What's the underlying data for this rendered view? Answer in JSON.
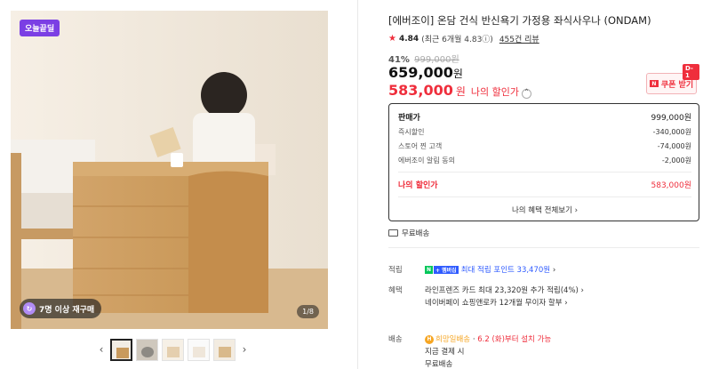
{
  "gallery": {
    "badge": "오늘끝딜",
    "repurchase": "7명 이상 재구매",
    "counter": "1/8",
    "thumb_count": 5
  },
  "product": {
    "title": "[에버조이] 온담 건식 반신욕기 가정용 좌식사우나 (ONDAM)",
    "rating_score": "4.84",
    "rating_detail": "(최근 6개월 4.83ⓘ)",
    "reviews": "455건 리뷰"
  },
  "price": {
    "discount_rate": "41%",
    "original": "999,000원",
    "sale": "659,000",
    "won": "원",
    "my_price": "583,000",
    "my_price_label": "나의 할인가",
    "coupon_label": "쿠폰 받기",
    "coupon_icon_label": "N",
    "dday": "D-1"
  },
  "breakdown": {
    "sale_label": "판매가",
    "sale_value": "999,000원",
    "rows": [
      {
        "label": "즉시할인",
        "value": "-340,000원"
      },
      {
        "label": "스토어 찐 고객",
        "value": "-74,000원"
      },
      {
        "label": "에버조이 알림 동의",
        "value": "-2,000원"
      }
    ],
    "my_label": "나의 할인가",
    "my_value": "583,000원",
    "all_benefits": "나의 혜택 전체보기 ›"
  },
  "shipping": {
    "label": "무료배송"
  },
  "points": {
    "label": "적립",
    "badge_n": "N",
    "badge_plus": "+ 멤버십",
    "text": "최대 적립 포인트 33,470원",
    "arrow": "›"
  },
  "benefits": {
    "label": "혜택",
    "line1": "라인프렌즈 카드 최대 23,320원 추가 적립(4%) ›",
    "line2": "네이버페이 쇼핑앤로카 12개월 무이자 할부 ›"
  },
  "delivery": {
    "label": "배송",
    "badge": "H",
    "hope": "희망일배송",
    "sep": "·",
    "install": "6.2 (화)부터 설치 가능",
    "line2": "지금 결제 시",
    "line3": "무료배송"
  },
  "colors": {
    "accent_red": "#ef2e3c",
    "badge_purple": "#7b3fe4",
    "naver_green": "#03c75a",
    "point_blue": "#2f5bff"
  }
}
